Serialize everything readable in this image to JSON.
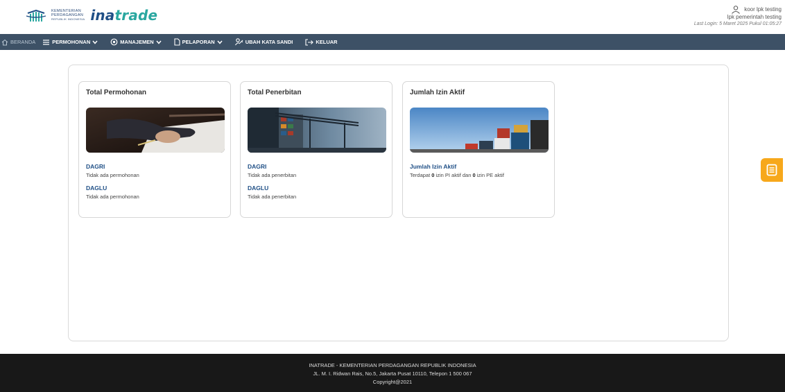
{
  "header": {
    "logo_small_text": [
      "KEMENTERIAN",
      "PERDAGANGAN",
      "REPUBLIK INDONESIA"
    ],
    "brand_prefix": "ina",
    "brand_suffix": "trade",
    "user_name": "koor lpk testing",
    "user_role": "lpk pemerintah testing",
    "last_login": "Last Login: 5 Maret 2025 Pukul 01:05:27"
  },
  "nav": {
    "items": [
      {
        "label": "BERANDA",
        "icon": "home-icon"
      },
      {
        "label": "PERMOHONAN",
        "icon": "list-icon",
        "dropdown": true
      },
      {
        "label": "MANAJEMEN",
        "icon": "gear-icon",
        "dropdown": true
      },
      {
        "label": "PELAPORAN",
        "icon": "document-icon",
        "dropdown": true
      },
      {
        "label": "UBAH KATA SANDI",
        "icon": "key-user-icon"
      },
      {
        "label": "KELUAR",
        "icon": "logout-icon"
      }
    ]
  },
  "cards": [
    {
      "title": "Total Permohonan",
      "image": "hand-signing-document-image",
      "sections": [
        {
          "label": "DAGRI",
          "text": "Tidak ada permohonan"
        },
        {
          "label": "DAGLU",
          "text": "Tidak ada permohonan"
        }
      ]
    },
    {
      "title": "Total Penerbitan",
      "image": "port-container-crane-image",
      "sections": [
        {
          "label": "DAGRI",
          "text": "Tidak ada penerbitan"
        },
        {
          "label": "DAGLU",
          "text": "Tidak ada penerbitan"
        }
      ]
    },
    {
      "title": "Jumlah Izin Aktif",
      "image": "shipping-containers-image",
      "sections": [
        {
          "label": "Jumlah Izin Aktif",
          "text_prefix": "Terdapat ",
          "count_pi": "0",
          "text_mid": " izin PI aktif dan ",
          "count_pe": "0",
          "text_suffix": " izin PE aktif"
        }
      ]
    }
  ],
  "floating_button": {
    "icon": "notes-icon"
  },
  "footer": {
    "line1": "INATRADE - KEMENTERIAN PERDAGANGAN REPUBLIK INDONESIA",
    "line2": "JL. M. I. Ridwan Rais, No.5, Jakarta Pusat 10110, Telepon 1 500 067",
    "line3": "Copyright@2021"
  },
  "colors": {
    "navbar": "#3d5166",
    "brand": "#1f4f86",
    "accent": "#2aa7a0",
    "floating_button": "#f7a81b",
    "footer": "#181818"
  }
}
